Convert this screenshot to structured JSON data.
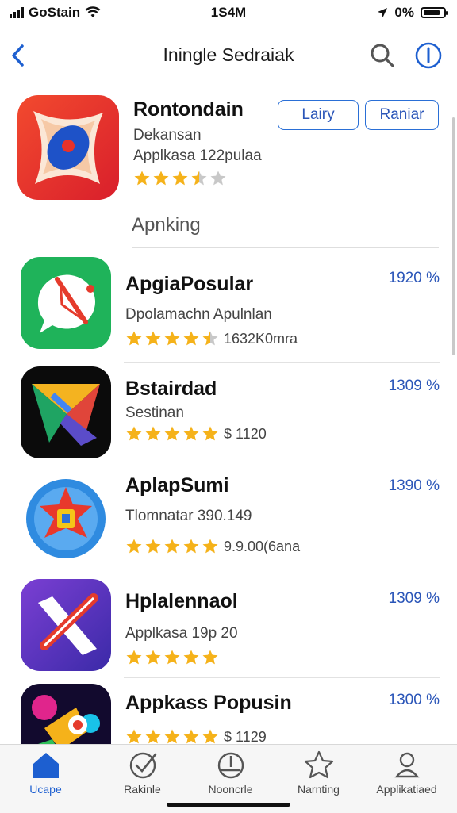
{
  "status_bar": {
    "carrier": "GoStain",
    "time": "1S4M",
    "battery": "0%"
  },
  "nav": {
    "title": "Iningle Sedraiak"
  },
  "featured": {
    "name": "Rontondain",
    "subtitle": "Dekansan",
    "meta": "Applkasa 122pulaa",
    "rating": 3.5,
    "button_1": "Lairy",
    "button_2": "Raniar"
  },
  "section_title": "Apnking",
  "apps": [
    {
      "name": "ApgiaPosular",
      "price": "1920 %",
      "subtitle": "Dpolamachn Apulnlan",
      "rating": 4.5,
      "rating_text": "1632K0mra"
    },
    {
      "name": "Bstairdad",
      "price": "1309 %",
      "subtitle": "Sestinan",
      "rating": 5,
      "rating_text": "$ 1120"
    },
    {
      "name": "AplapSumi",
      "price": "1390 %",
      "subtitle": "Tlomnatar 390.149",
      "rating": 5,
      "rating_text": "9.9.00(6ana"
    },
    {
      "name": "Hplalennaol",
      "price": "1309 %",
      "subtitle": "Applkasa 19p 20",
      "rating": 5,
      "rating_text": ""
    },
    {
      "name": "Appkass Popusin",
      "price": "1300 %",
      "subtitle": "",
      "rating": 5,
      "rating_text": "$ 1129"
    }
  ],
  "tabs": [
    {
      "label": "Ucape",
      "icon": "home-icon",
      "active": true
    },
    {
      "label": "Rakinle",
      "icon": "check-circle-icon",
      "active": false
    },
    {
      "label": "Nooncrle",
      "icon": "clock-icon",
      "active": false
    },
    {
      "label": "Narnting",
      "icon": "star-icon",
      "active": false
    },
    {
      "label": "Applikatiaed",
      "icon": "person-icon",
      "active": false
    }
  ],
  "colors": {
    "accent": "#2a55b8",
    "star": "#f5b21a",
    "star_empty": "#c8c8c8"
  }
}
